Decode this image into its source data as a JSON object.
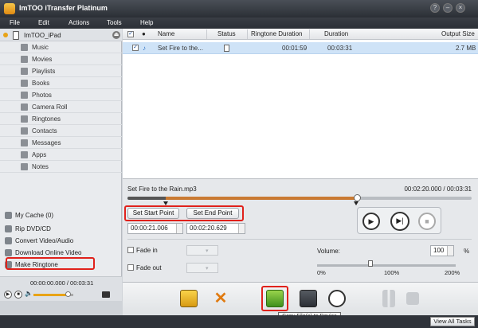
{
  "app": {
    "title": "ImTOO iTransfer Platinum"
  },
  "menu": [
    "File",
    "Edit",
    "Actions",
    "Tools",
    "Help"
  ],
  "sidebar": {
    "device": "ImTOO_iPad",
    "items": [
      {
        "label": "Music",
        "icon": "music-icon"
      },
      {
        "label": "Movies",
        "icon": "movie-icon"
      },
      {
        "label": "Playlists",
        "icon": "playlist-icon"
      },
      {
        "label": "Books",
        "icon": "book-icon"
      },
      {
        "label": "Photos",
        "icon": "photo-icon"
      },
      {
        "label": "Camera Roll",
        "icon": "camera-icon"
      },
      {
        "label": "Ringtones",
        "icon": "ringtone-icon"
      },
      {
        "label": "Contacts",
        "icon": "contacts-icon"
      },
      {
        "label": "Messages",
        "icon": "messages-icon"
      },
      {
        "label": "Apps",
        "icon": "apps-icon"
      },
      {
        "label": "Notes",
        "icon": "notes-icon"
      }
    ],
    "lower": [
      {
        "label": "My Cache (0)",
        "icon": "cache-icon"
      },
      {
        "label": "Rip DVD/CD",
        "icon": "disc-icon"
      },
      {
        "label": "Convert Video/Audio",
        "icon": "convert-icon"
      },
      {
        "label": "Download Online Video",
        "icon": "download-icon"
      },
      {
        "label": "Make Ringtone",
        "icon": "bell-icon"
      }
    ],
    "player_time": "00:00:00.000 / 00:03:31",
    "volume": 0.85
  },
  "list": {
    "columns": [
      "Name",
      "Status",
      "Ringtone Duration",
      "Duration",
      "Output Size"
    ],
    "rows": [
      {
        "name": "Set Fire to the...",
        "ringtone_duration": "00:01:59",
        "duration": "00:03:31",
        "size": "2.7 MB"
      }
    ]
  },
  "editor": {
    "file": "Set Fire to the Rain.mp3",
    "time": "00:02:20.000 / 00:03:31",
    "start_label": "Set Start Point",
    "end_label": "Set End Point",
    "start_value": "00:00:21.006",
    "end_value": "00:02:20.629",
    "fade_in": "Fade in",
    "fade_out": "Fade out",
    "volume_label": "Volume:",
    "volume_value": "100",
    "percent": "%",
    "ticks": [
      "0%",
      "100%",
      "200%"
    ]
  },
  "toolbar": {
    "tooltip": "Copy File(s) to Device"
  },
  "status": {
    "view_all": "View All Tasks"
  }
}
